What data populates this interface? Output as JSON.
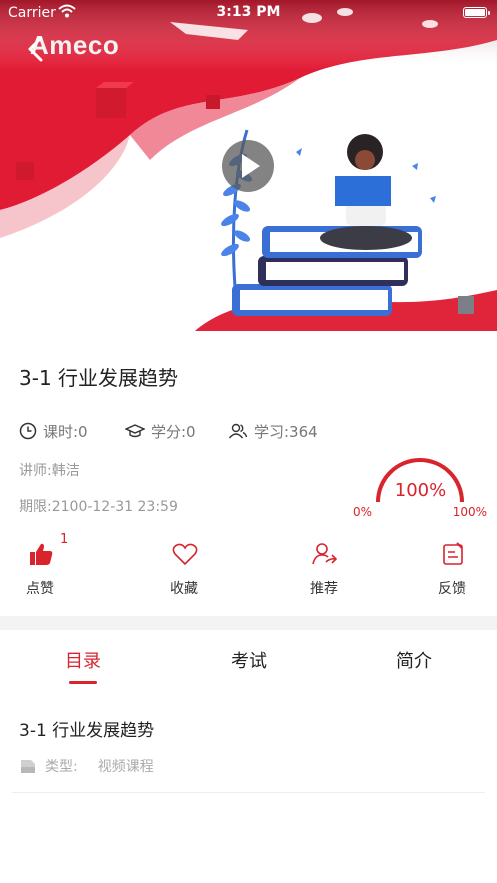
{
  "status_bar": {
    "carrier": "Carrier",
    "time": "3:13 PM"
  },
  "header": {
    "brand": "Ameco"
  },
  "course": {
    "title": "3-1 行业发展趋势",
    "hours": "课时:0",
    "credits": "学分:0",
    "learners": "学习:364",
    "lecturer": "讲师:韩洁",
    "deadline": "期限:2100-12-31 23:59",
    "progress_percent": 100,
    "progress_label": "100%",
    "progress_min": "0%",
    "progress_max": "100%"
  },
  "actions": {
    "like_label": "点赞",
    "like_count": "1",
    "favorite_label": "收藏",
    "recommend_label": "推荐",
    "feedback_label": "反馈"
  },
  "tabs": [
    {
      "label": "目录",
      "active": true
    },
    {
      "label": "考试",
      "active": false
    },
    {
      "label": "简介",
      "active": false
    }
  ],
  "catalog": {
    "item_title": "3-1 行业发展趋势",
    "type_label": "类型:",
    "type_value": "视频课程"
  },
  "colors": {
    "accent": "#d9232d",
    "hero_red": "#e0243a"
  }
}
